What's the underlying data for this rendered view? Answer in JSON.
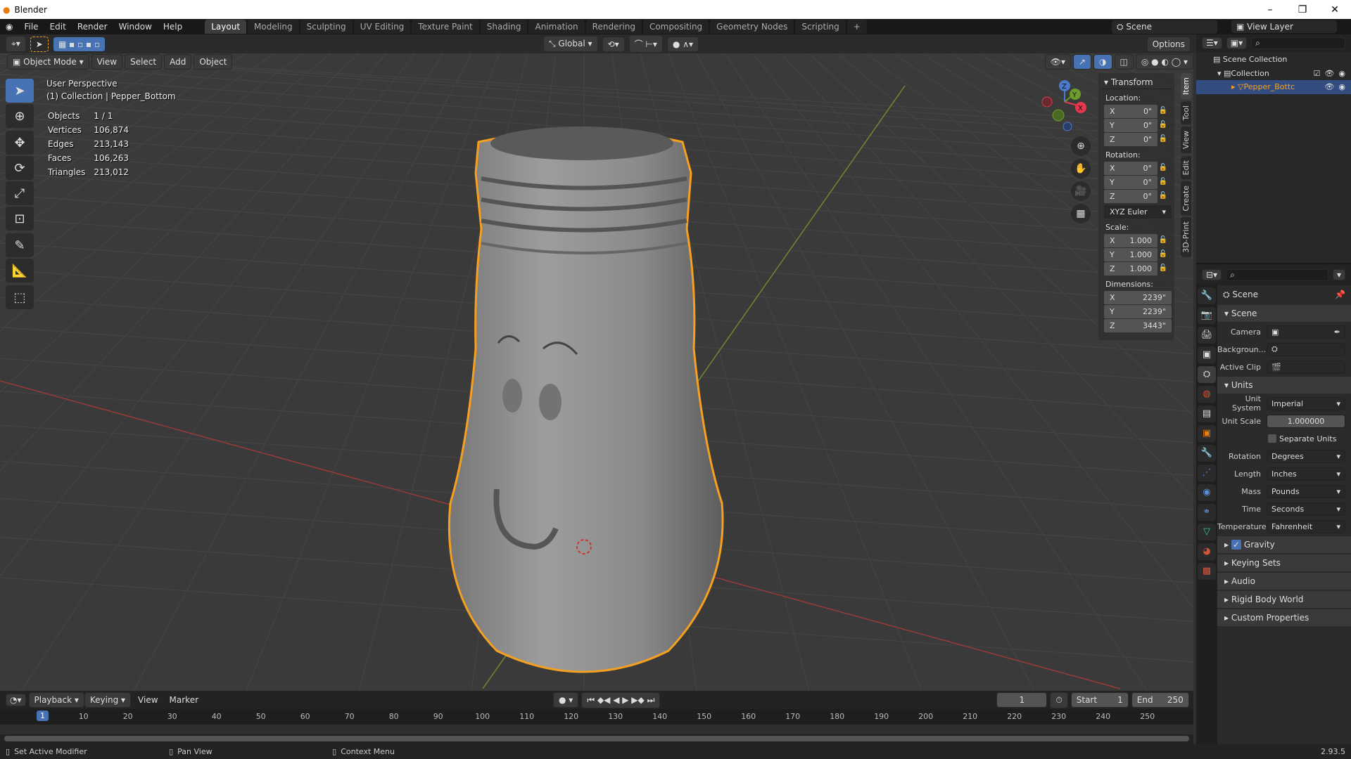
{
  "window": {
    "title": "Blender",
    "version": "2.93.5"
  },
  "menu": [
    "File",
    "Edit",
    "Render",
    "Window",
    "Help"
  ],
  "workspaces": [
    "Layout",
    "Modeling",
    "Sculpting",
    "UV Editing",
    "Texture Paint",
    "Shading",
    "Animation",
    "Rendering",
    "Compositing",
    "Geometry Nodes",
    "Scripting",
    "+"
  ],
  "active_workspace": "Layout",
  "header": {
    "scene": "Scene",
    "view_layer": "View Layer",
    "orientation": "Global",
    "options": "Options"
  },
  "viewport_header": {
    "mode": "Object Mode",
    "menus": [
      "View",
      "Select",
      "Add",
      "Object"
    ]
  },
  "overlay": {
    "perspective": "User Perspective",
    "collection": "(1) Collection | Pepper_Bottom",
    "stats": [
      {
        "label": "Objects",
        "value": "1 / 1"
      },
      {
        "label": "Vertices",
        "value": "106,874"
      },
      {
        "label": "Edges",
        "value": "213,143"
      },
      {
        "label": "Faces",
        "value": "106,263"
      },
      {
        "label": "Triangles",
        "value": "213,012"
      }
    ]
  },
  "gizmo": {
    "axes": [
      "X",
      "Y",
      "Z"
    ],
    "colors": {
      "x": "#e5384f",
      "y": "#6e9c2c",
      "z": "#4a7acb"
    }
  },
  "npanel": {
    "title": "Transform",
    "location_label": "Location:",
    "location": [
      {
        "axis": "X",
        "value": "0\""
      },
      {
        "axis": "Y",
        "value": "0\""
      },
      {
        "axis": "Z",
        "value": "0\""
      }
    ],
    "rotation_label": "Rotation:",
    "rotation": [
      {
        "axis": "X",
        "value": "0°"
      },
      {
        "axis": "Y",
        "value": "0°"
      },
      {
        "axis": "Z",
        "value": "0°"
      }
    ],
    "rotation_mode": "XYZ Euler",
    "scale_label": "Scale:",
    "scale": [
      {
        "axis": "X",
        "value": "1.000"
      },
      {
        "axis": "Y",
        "value": "1.000"
      },
      {
        "axis": "Z",
        "value": "1.000"
      }
    ],
    "dimensions_label": "Dimensions:",
    "dimensions": [
      {
        "axis": "X",
        "value": "2239\""
      },
      {
        "axis": "Y",
        "value": "2239\""
      },
      {
        "axis": "Z",
        "value": "3443\""
      }
    ],
    "tabs": [
      "Item",
      "Tool",
      "View",
      "Edit",
      "Create",
      "3D-Print"
    ]
  },
  "outliner": {
    "items": [
      {
        "label": "Scene Collection"
      },
      {
        "label": "Collection"
      },
      {
        "label": "Pepper_Bottc"
      }
    ]
  },
  "properties": {
    "context": "Scene",
    "scene_section": "Scene",
    "camera_label": "Camera",
    "background_label": "Backgroun...",
    "active_clip_label": "Active Clip",
    "units_section": "Units",
    "unit_system_label": "Unit System",
    "unit_system": "Imperial",
    "unit_scale_label": "Unit Scale",
    "unit_scale": "1.000000",
    "separate_units": "Separate Units",
    "rotation_label": "Rotation",
    "rotation": "Degrees",
    "length_label": "Length",
    "length": "Inches",
    "mass_label": "Mass",
    "mass": "Pounds",
    "time_label": "Time",
    "time": "Seconds",
    "temperature_label": "Temperature",
    "temperature": "Fahrenheit",
    "panels": [
      "Gravity",
      "Keying Sets",
      "Audio",
      "Rigid Body World",
      "Custom Properties"
    ],
    "gravity_checked": true
  },
  "timeline": {
    "menus": [
      "Playback",
      "Keying",
      "View",
      "Marker"
    ],
    "current_frame": "1",
    "start_label": "Start",
    "start": "1",
    "end_label": "End",
    "end": "250",
    "ticks": [
      "10",
      "20",
      "30",
      "40",
      "50",
      "60",
      "70",
      "80",
      "90",
      "100",
      "110",
      "120",
      "130",
      "140",
      "150",
      "160",
      "170",
      "180",
      "190",
      "200",
      "210",
      "220",
      "230",
      "240",
      "250"
    ]
  },
  "status": {
    "left": "Set Active Modifier",
    "middle": "Pan View",
    "right": "Context Menu"
  },
  "colors": {
    "accent": "#4772b3",
    "selection": "#f5a020"
  }
}
